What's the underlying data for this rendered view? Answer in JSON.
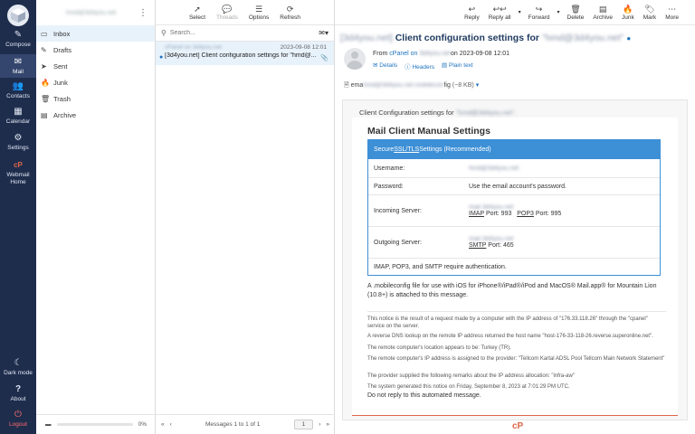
{
  "nav": {
    "items": [
      {
        "icon": "compose-icon",
        "label": "Compose",
        "glyph": "✎"
      },
      {
        "icon": "mail-icon",
        "label": "Mail",
        "glyph": "✉"
      },
      {
        "icon": "contacts-icon",
        "label": "Contacts",
        "glyph": "👥"
      },
      {
        "icon": "calendar-icon",
        "label": "Calendar",
        "glyph": "▦"
      },
      {
        "icon": "settings-icon",
        "label": "Settings",
        "glyph": "⚙"
      },
      {
        "icon": "cpanel-icon",
        "label": "Webmail Home",
        "glyph": "cP"
      }
    ],
    "bottom": [
      {
        "icon": "moon-icon",
        "label": "Dark mode",
        "glyph": "☾"
      },
      {
        "icon": "help-icon",
        "label": "About",
        "glyph": "?"
      },
      {
        "icon": "power-icon",
        "label": "Logout",
        "glyph": "⏻"
      }
    ]
  },
  "account": "hmd@3d4you.net",
  "folders": [
    {
      "icon": "inbox-icon",
      "glyph": "▭",
      "label": "Inbox"
    },
    {
      "icon": "drafts-icon",
      "glyph": "✎",
      "label": "Drafts"
    },
    {
      "icon": "sent-icon",
      "glyph": "➤",
      "label": "Sent"
    },
    {
      "icon": "junk-icon",
      "glyph": "🔥",
      "label": "Junk"
    },
    {
      "icon": "trash-icon",
      "glyph": "🗑",
      "label": "Trash"
    },
    {
      "icon": "archive-icon",
      "glyph": "▤",
      "label": "Archive"
    }
  ],
  "quota": {
    "percent": "0%"
  },
  "list_toolbar": [
    {
      "icon": "cursor-icon",
      "glyph": "➚",
      "label": "Select",
      "disabled": false
    },
    {
      "icon": "threads-icon",
      "glyph": "💬",
      "label": "Threads",
      "disabled": true
    },
    {
      "icon": "options-icon",
      "glyph": "☰",
      "label": "Options",
      "disabled": false
    },
    {
      "icon": "refresh-icon",
      "glyph": "⟳",
      "label": "Refresh",
      "disabled": false
    }
  ],
  "search": {
    "placeholder": "Search..."
  },
  "messages": [
    {
      "from": "cPanel on 3d4you.net",
      "date": "2023-09-08 12:01",
      "subject": "[3d4you.net] Client configuration settings for \"hmd@..."
    }
  ],
  "pager": {
    "text": "Messages 1 to 1 of 1",
    "page": "1"
  },
  "viewer_toolbar": [
    {
      "icon": "reply-icon",
      "glyph": "↩",
      "label": "Reply"
    },
    {
      "icon": "reply-all-icon",
      "glyph": "↩↩",
      "label": "Reply all"
    },
    {
      "icon": "forward-icon",
      "glyph": "↪",
      "label": "Forward"
    },
    {
      "icon": "delete-icon",
      "glyph": "🗑",
      "label": "Delete"
    },
    {
      "icon": "archive-icon",
      "glyph": "▤",
      "label": "Archive"
    },
    {
      "icon": "junk-icon",
      "glyph": "🔥",
      "label": "Junk"
    },
    {
      "icon": "mark-icon",
      "glyph": "🏷",
      "label": "Mark"
    },
    {
      "icon": "more-icon",
      "glyph": "⋯",
      "label": "More"
    }
  ],
  "email": {
    "subject_prefix": "[3d4you.net]",
    "subject_main": " Client configuration settings for ",
    "subject_addr": "\"hmd@3d4you.net\"",
    "from_label": "From ",
    "from_name": "cPanel on",
    "from_domain": "3d4you.net",
    "from_date": "on 2023-09-08 12:01",
    "header_links": [
      "Details",
      "Headers",
      "Plain text"
    ],
    "attachment_name": "ema",
    "attachment_blur": "hmd@3d4you.net.mobilecon",
    "attachment_tail": "fig",
    "attachment_size": "(~8 KB)",
    "intro": "Client Configuration settings for",
    "intro_addr": "\"hmd@3d4you.net\".",
    "heading": "Mail Client Manual Settings",
    "table_header_pre": "Secure ",
    "table_header_link": "SSL/TLS",
    "table_header_post": " Settings (Recommended)",
    "rows": {
      "username_k": "Username:",
      "username_v": "hmd@3d4you.net",
      "password_k": "Password:",
      "password_v": "Use the email account's password.",
      "incoming_k": "Incoming Server:",
      "incoming_host": "mail.3d4you.net",
      "imap": "IMAP",
      "imap_port": " Port: 993",
      "pop3": "POP3",
      "pop3_port": " Port: 995",
      "outgoing_k": "Outgoing Server:",
      "outgoing_host": "mail.3d4you.net",
      "smtp": "SMTP",
      "smtp_port": " Port: 465",
      "auth": "IMAP, POP3, and SMTP require authentication."
    },
    "paragraph": "A .mobileconfig file for use with iOS for iPhone®/iPad®/iPod and MacOS® Mail.app® for Mountain Lion (10.8+) is attached to this message.",
    "notes": [
      "This notice is the result of a request made by a computer with the IP address of \"176.33.118.26\" through the \"cpanel\" service on the server.",
      "A reverse DNS lookup on the remote IP address returned the host name \"host-176-33-118-26.reverse.superonline.net\".",
      "The remote computer's location appears to be: Turkey (TR).",
      "The remote computer's IP address is assigned to the provider: \"Tellcom Kartal ADSL Pool Tellcom Main Network Statement\"",
      "The provider supplied the following remarks about the IP address allocation: \"infra-aw\"",
      "The system generated this notice on Friday, September 8, 2023 at 7:01:29 PM UTC."
    ],
    "do_not_reply": "Do not reply to this automated message.",
    "footer_logo": "cP"
  }
}
